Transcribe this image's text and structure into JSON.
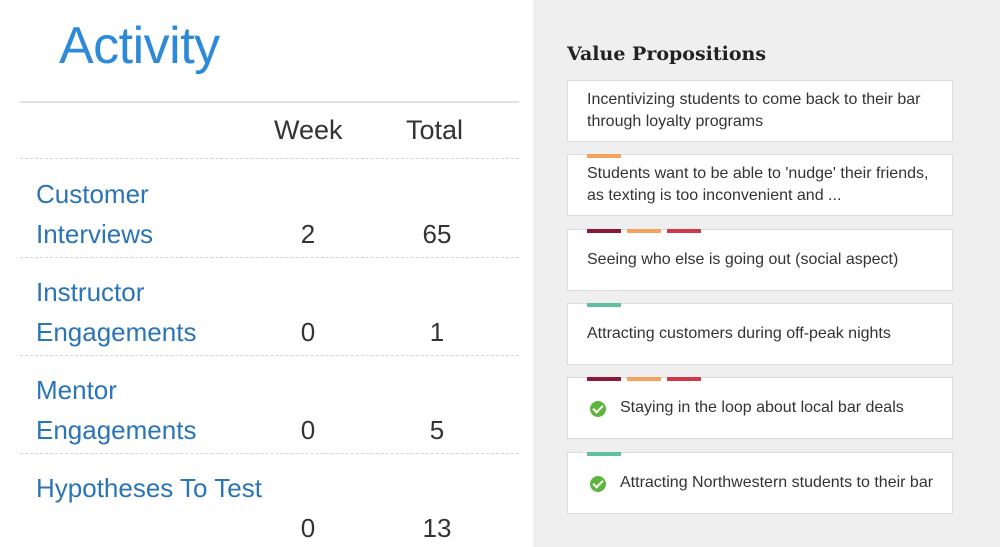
{
  "activity": {
    "title": "Activity",
    "columns": {
      "week": "Week",
      "total": "Total"
    },
    "rows": [
      {
        "label": "Customer Interviews",
        "week": "2",
        "total": "65"
      },
      {
        "label": "Instructor Engagements",
        "week": "0",
        "total": "1"
      },
      {
        "label": "Mentor Engagements",
        "week": "0",
        "total": "5"
      },
      {
        "label": "Hypotheses To Test",
        "week": "0",
        "total": "13"
      }
    ]
  },
  "value_propositions": {
    "title": "Value Propositions",
    "cards": [
      {
        "text": "Incentivizing students to come back to their bar through loyalty programs",
        "checked": false,
        "tags": []
      },
      {
        "text": "Students want to be able to 'nudge' their friends, as texting is too inconvenient and ...",
        "checked": false,
        "tags": [
          "#f5a25d"
        ]
      },
      {
        "text": "Seeing who else is going out (social aspect)",
        "checked": false,
        "tags": [
          "#8b1a3a",
          "#f5a25d",
          "#d0394a"
        ]
      },
      {
        "text": "Attracting customers during off-peak nights",
        "checked": false,
        "tags": [
          "#5fbf9f"
        ]
      },
      {
        "text": "Staying in the loop about local bar deals",
        "checked": true,
        "tags": [
          "#8b1a3a",
          "#f5a25d",
          "#d0394a"
        ]
      },
      {
        "text": "Attracting Northwestern students to their bar",
        "checked": true,
        "tags": [
          "#5fbf9f"
        ]
      }
    ]
  },
  "icons": {
    "check": "check-circle-icon"
  },
  "colors": {
    "accent_blue": "#2d8ad6",
    "link_blue": "#2a74b8",
    "check_green": "#5db53b",
    "panel_bg": "#efefef"
  }
}
